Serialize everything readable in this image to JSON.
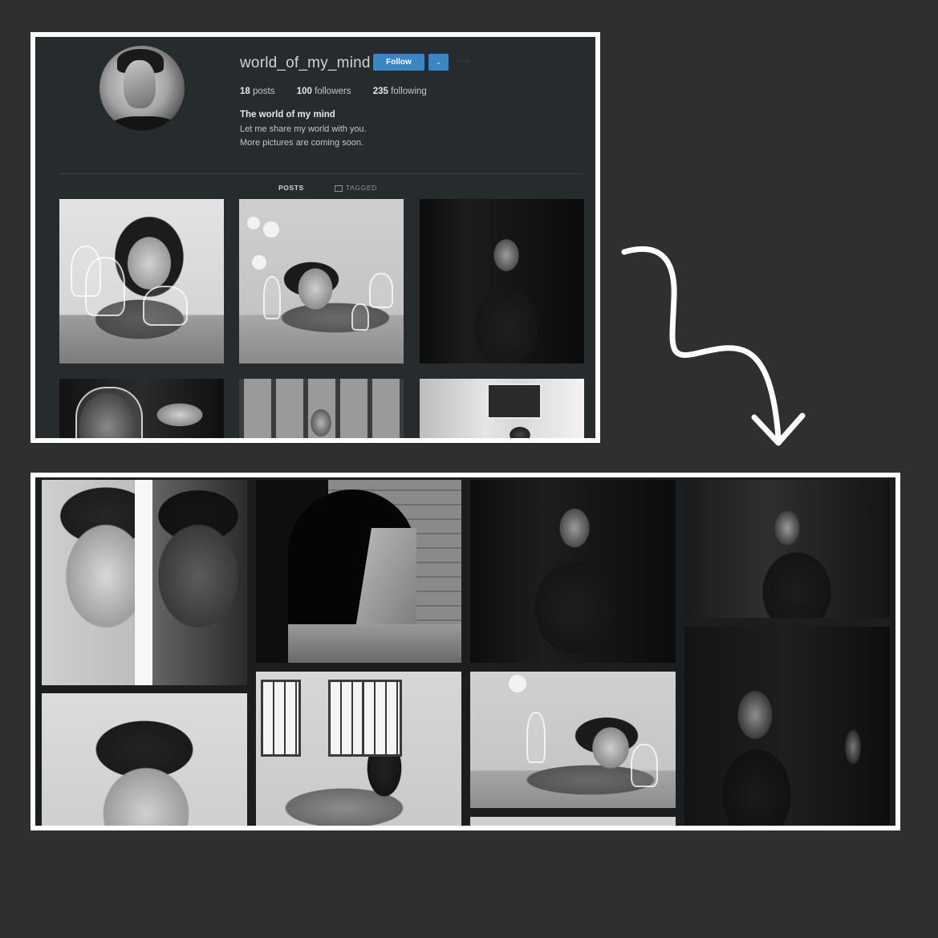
{
  "profile": {
    "username": "world_of_my_mind",
    "follow_label": "Follow",
    "dropdown_icon": "chevron-down-icon",
    "more_icon": "more-dots-icon",
    "stats": {
      "posts_count": "18",
      "posts_label": "posts",
      "followers_count": "100",
      "followers_label": "followers",
      "following_count": "235",
      "following_label": "following"
    },
    "bio": {
      "name": "The world of my mind",
      "line1": "Let me share my world with you.",
      "line2": "More pictures are coming soon."
    },
    "tabs": [
      {
        "label": "POSTS",
        "active": true
      },
      {
        "label": "TAGGED",
        "active": false
      }
    ]
  },
  "colors": {
    "background": "#2f2f2f",
    "frame_border": "#ffffff",
    "profile_bg": "#262b2e",
    "follow_button": "#3a86c2"
  }
}
